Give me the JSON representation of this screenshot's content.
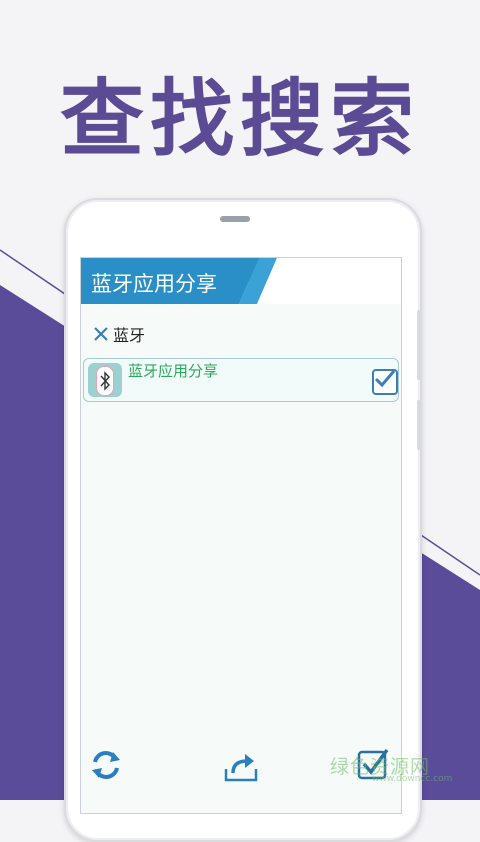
{
  "headline": "查找搜索",
  "app": {
    "title": "蓝牙应用分享"
  },
  "search": {
    "value": "蓝牙",
    "clear_icon": "close-icon"
  },
  "results": [
    {
      "name": "蓝牙应用分享",
      "icon": "bluetooth-icon",
      "checked": true
    }
  ],
  "bottom_bar": {
    "icons": [
      "refresh-icon",
      "share-icon",
      "confirm-check-icon"
    ]
  },
  "watermark": {
    "main": "绿色资源网",
    "sub": "www.downcc.com"
  },
  "colors": {
    "brand_purple": "#5a4b94",
    "titlebar_blue": "#2a96cc",
    "accent_blue": "#3a7fb5",
    "app_name_green": "#2aaa5a"
  }
}
